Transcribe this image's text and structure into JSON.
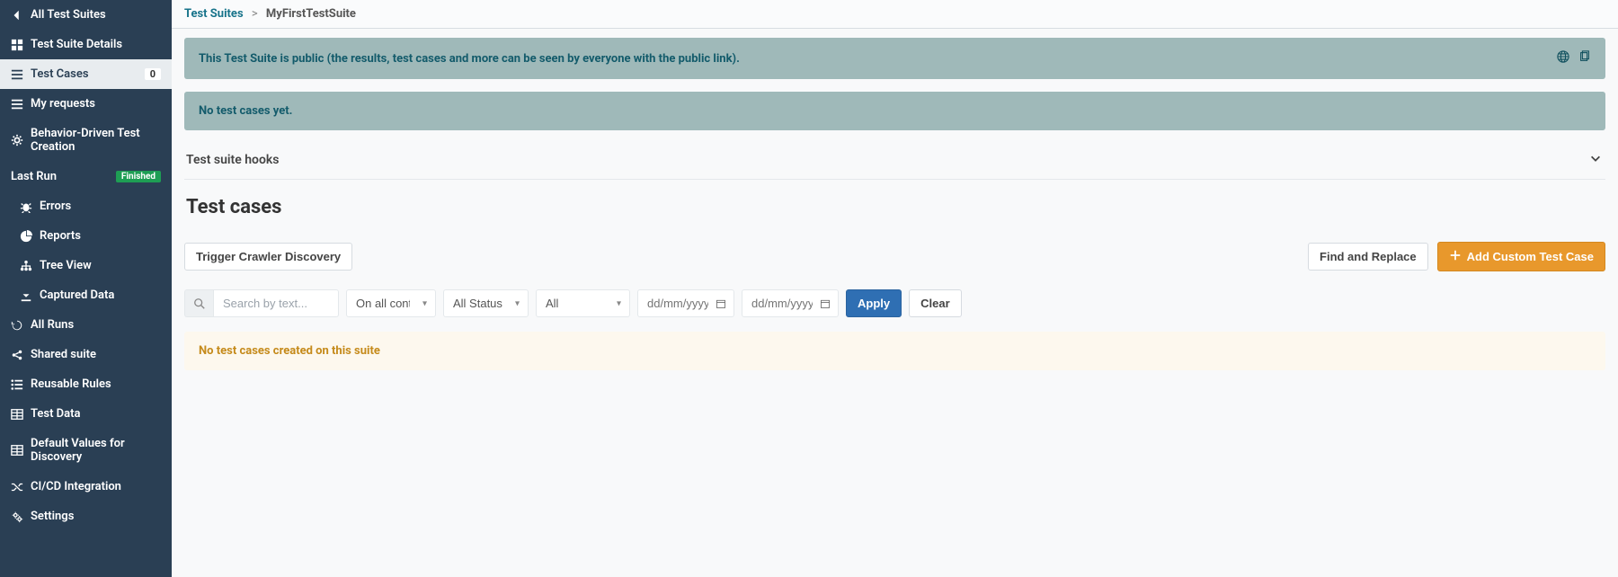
{
  "sidebar": {
    "all_suites": "All Test Suites",
    "details": "Test Suite Details",
    "test_cases": "Test Cases",
    "test_cases_count": "0",
    "my_requests": "My requests",
    "bdd": "Behavior-Driven Test Creation",
    "last_run": "Last Run",
    "last_run_status": "Finished",
    "errors": "Errors",
    "reports": "Reports",
    "tree": "Tree View",
    "captured": "Captured Data",
    "all_runs": "All Runs",
    "shared": "Shared suite",
    "rules": "Reusable Rules",
    "test_data": "Test Data",
    "defaults": "Default Values for Discovery",
    "cicd": "CI/CD Integration",
    "settings": "Settings"
  },
  "breadcrumb": {
    "root": "Test Suites",
    "sep": ">",
    "current": "MyFirstTestSuite"
  },
  "banners": {
    "public_notice": "This Test Suite is public (the results, test cases and more can be seen by everyone with the public link).",
    "no_cases": "No test cases yet."
  },
  "hooks": {
    "label": "Test suite hooks"
  },
  "section": {
    "title": "Test cases"
  },
  "toolbar": {
    "trigger": "Trigger Crawler Discovery",
    "find_replace": "Find and Replace",
    "add_custom": "Add Custom Test Case"
  },
  "filters": {
    "search_placeholder": "Search by text...",
    "content_scope": "On all content",
    "statuses": "All Statuses",
    "all": "All",
    "date_placeholder": "dd/mm/yyyy",
    "apply": "Apply",
    "clear": "Clear"
  },
  "empty": {
    "message": "No test cases created on this suite"
  }
}
